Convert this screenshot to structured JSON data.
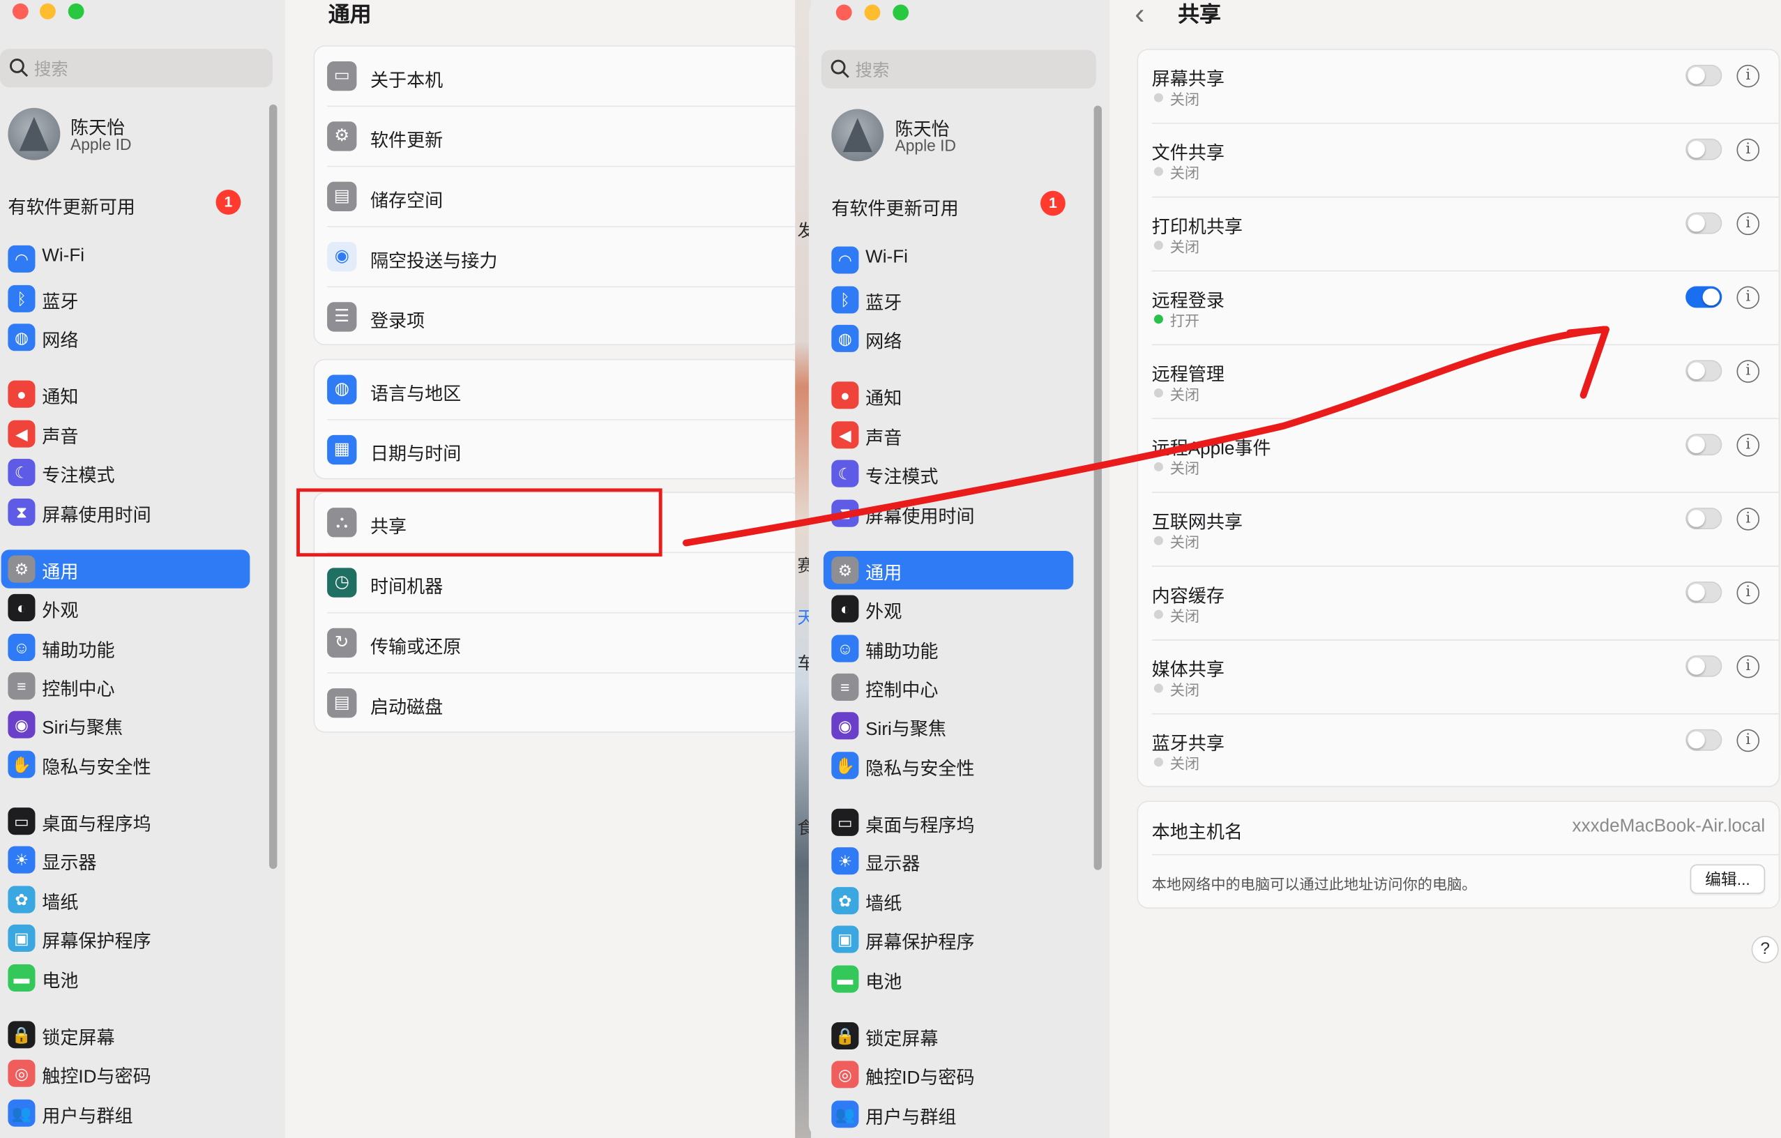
{
  "sidebar": {
    "search_placeholder": "搜索",
    "account": {
      "name": "陈天怡",
      "sub": "Apple ID"
    },
    "update": {
      "label": "有软件更新可用",
      "badge": "1"
    },
    "groups": [
      [
        {
          "label": "Wi-Fi",
          "icon": "wifi-icon",
          "color": "#2f7bf6"
        },
        {
          "label": "蓝牙",
          "icon": "bluetooth-icon",
          "color": "#2f7bf6"
        },
        {
          "label": "网络",
          "icon": "globe-icon",
          "color": "#2f7bf6"
        }
      ],
      [
        {
          "label": "通知",
          "icon": "bell-icon",
          "color": "#f0443a"
        },
        {
          "label": "声音",
          "icon": "speaker-icon",
          "color": "#f0443a"
        },
        {
          "label": "专注模式",
          "icon": "moon-icon",
          "color": "#5e5ce6"
        },
        {
          "label": "屏幕使用时间",
          "icon": "hourglass-icon",
          "color": "#5e5ce6"
        }
      ],
      [
        {
          "label": "通用",
          "icon": "gear-icon",
          "color": "#8e8e93"
        },
        {
          "label": "外观",
          "icon": "appearance-icon",
          "color": "#1d1d1f"
        },
        {
          "label": "辅助功能",
          "icon": "accessibility-icon",
          "color": "#2f7bf6"
        },
        {
          "label": "控制中心",
          "icon": "control-center-icon",
          "color": "#8e8e93"
        },
        {
          "label": "Siri与聚焦",
          "icon": "siri-icon",
          "color": "#6a3fc9"
        },
        {
          "label": "隐私与安全性",
          "icon": "hand-icon",
          "color": "#2f7bf6"
        }
      ],
      [
        {
          "label": "桌面与程序坞",
          "icon": "dock-icon",
          "color": "#1d1d1f"
        },
        {
          "label": "显示器",
          "icon": "sun-icon",
          "color": "#2f7bf6"
        },
        {
          "label": "墙纸",
          "icon": "flower-icon",
          "color": "#3aa7e0"
        },
        {
          "label": "屏幕保护程序",
          "icon": "screensaver-icon",
          "color": "#3aa7e0"
        },
        {
          "label": "电池",
          "icon": "battery-icon",
          "color": "#34c759"
        }
      ],
      [
        {
          "label": "锁定屏幕",
          "icon": "lock-icon",
          "color": "#1d1d1f"
        },
        {
          "label": "触控ID与密码",
          "icon": "fingerprint-icon",
          "color": "#ef5d5d"
        },
        {
          "label": "用户与群组",
          "icon": "users-icon",
          "color": "#2f7bf6"
        }
      ]
    ],
    "selected": "通用"
  },
  "general": {
    "title": "通用",
    "groups": [
      [
        {
          "label": "关于本机",
          "icon": "laptop-icon",
          "color": "#8e8e93"
        },
        {
          "label": "软件更新",
          "icon": "gear-icon",
          "color": "#8e8e93"
        },
        {
          "label": "储存空间",
          "icon": "disk-icon",
          "color": "#8e8e93"
        },
        {
          "label": "隔空投送与接力",
          "icon": "airdrop-icon",
          "color": "#e3edf9"
        },
        {
          "label": "登录项",
          "icon": "list-icon",
          "color": "#8e8e93"
        }
      ],
      [
        {
          "label": "语言与地区",
          "icon": "globe-icon",
          "color": "#2f7bf6"
        },
        {
          "label": "日期与时间",
          "icon": "calendar-icon",
          "color": "#2f7bf6"
        }
      ],
      [
        {
          "label": "共享",
          "icon": "sharing-icon",
          "color": "#8e8e93"
        },
        {
          "label": "时间机器",
          "icon": "time-machine-icon",
          "color": "#1f6f63"
        },
        {
          "label": "传输或还原",
          "icon": "restore-icon",
          "color": "#8e8e93"
        },
        {
          "label": "启动磁盘",
          "icon": "startup-disk-icon",
          "color": "#8e8e93"
        }
      ]
    ]
  },
  "background_fragments": [
    "发",
    "天",
    "车",
    "赛",
    "食"
  ],
  "sharing": {
    "title": "共享",
    "items": [
      {
        "label": "屏幕共享",
        "status": "关闭",
        "on": false
      },
      {
        "label": "文件共享",
        "status": "关闭",
        "on": false
      },
      {
        "label": "打印机共享",
        "status": "关闭",
        "on": false
      },
      {
        "label": "远程登录",
        "status": "打开",
        "on": true
      },
      {
        "label": "远程管理",
        "status": "关闭",
        "on": false
      },
      {
        "label": "远程Apple事件",
        "status": "关闭",
        "on": false
      },
      {
        "label": "互联网共享",
        "status": "关闭",
        "on": false
      },
      {
        "label": "内容缓存",
        "status": "关闭",
        "on": false
      },
      {
        "label": "媒体共享",
        "status": "关闭",
        "on": false
      },
      {
        "label": "蓝牙共享",
        "status": "关闭",
        "on": false
      }
    ],
    "info_glyph": "i",
    "hostname_label": "本地主机名",
    "hostname_value": "xxxdeMacBook-Air.local",
    "hostname_desc": "本地网络中的电脑可以通过此地址访问你的电脑。",
    "edit_button": "编辑...",
    "help_glyph": "?"
  },
  "annotation": {
    "color": "#ea1b1b"
  }
}
